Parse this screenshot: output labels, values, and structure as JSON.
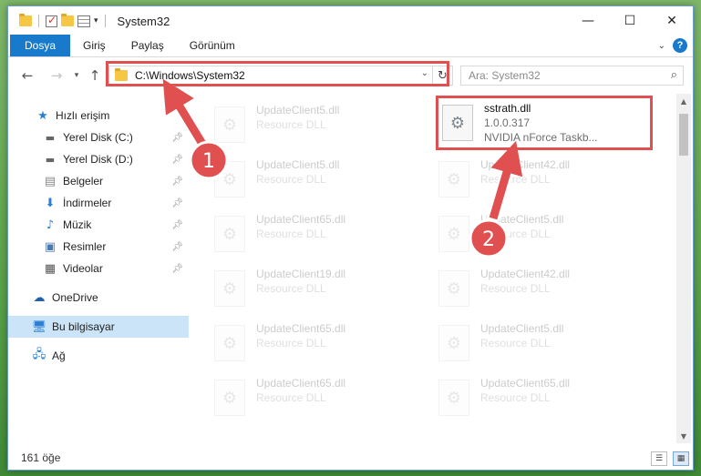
{
  "window": {
    "title": "System32",
    "controls": {
      "minimize": "—",
      "maximize": "☐",
      "close": "✕"
    }
  },
  "ribbon": {
    "tabs": [
      "Dosya",
      "Giriş",
      "Paylaş",
      "Görünüm"
    ],
    "help": "?"
  },
  "navbar": {
    "address": "C:\\Windows\\System32",
    "search_placeholder": "Ara: System32"
  },
  "sidebar": {
    "quick_access": "Hızlı erişim",
    "items": [
      {
        "label": "Yerel Disk (C:)",
        "icon": "drive-icon"
      },
      {
        "label": "Yerel Disk (D:)",
        "icon": "drive-icon"
      },
      {
        "label": "Belgeler",
        "icon": "documents-icon"
      },
      {
        "label": "İndirmeler",
        "icon": "downloads-icon"
      },
      {
        "label": "Müzik",
        "icon": "music-icon"
      },
      {
        "label": "Resimler",
        "icon": "pictures-icon"
      },
      {
        "label": "Videolar",
        "icon": "videos-icon"
      }
    ],
    "onedrive": "OneDrive",
    "this_pc": "Bu bilgisayar",
    "network": "Ağ"
  },
  "files": {
    "highlighted": {
      "name": "sstrath.dll",
      "version": "1.0.0.317",
      "description": "NVIDIA nForce Taskb..."
    },
    "left_column": [
      {
        "name": "UpdateClient5.dll",
        "type": "Resource DLL"
      },
      {
        "name": "UpdateClient5.dll",
        "type": "Resource DLL"
      },
      {
        "name": "UpdateClient65.dll",
        "type": "Resource DLL"
      },
      {
        "name": "UpdateClient19.dll",
        "type": "Resource DLL"
      },
      {
        "name": "UpdateClient65.dll",
        "type": "Resource DLL"
      },
      {
        "name": "UpdateClient65.dll",
        "type": "Resource DLL"
      }
    ],
    "right_column": [
      {
        "name": "UpdateClient42.dll",
        "type": "Resource DLL"
      },
      {
        "name": "UpdateClient5.dll",
        "type": "Resource DLL"
      },
      {
        "name": "UpdateClient42.dll",
        "type": "Resource DLL"
      },
      {
        "name": "UpdateClient5.dll",
        "type": "Resource DLL"
      },
      {
        "name": "UpdateClient65.dll",
        "type": "Resource DLL"
      }
    ]
  },
  "status": {
    "count": "161 öğe"
  },
  "annotations": {
    "step1": "1",
    "step2": "2",
    "color": "#e05050"
  }
}
